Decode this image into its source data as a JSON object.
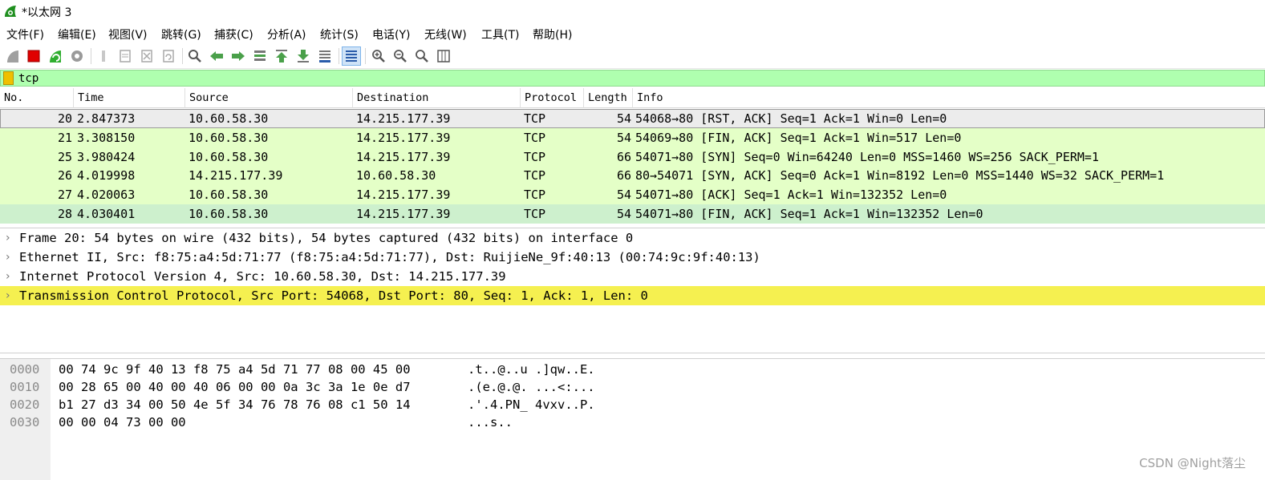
{
  "window": {
    "title": "*以太网 3",
    "accent_color": "#1f8f1f"
  },
  "menu": {
    "items": [
      "文件(F)",
      "编辑(E)",
      "视图(V)",
      "跳转(G)",
      "捕获(C)",
      "分析(A)",
      "统计(S)",
      "电话(Y)",
      "无线(W)",
      "工具(T)",
      "帮助(H)"
    ]
  },
  "toolbar": {
    "buttons": [
      "shark-fin-start-icon",
      "stop-capture-icon",
      "restart-capture-icon",
      "capture-options-icon",
      "open-file-icon",
      "save-file-icon",
      "close-file-icon",
      "reload-file-icon",
      "find-packet-icon",
      "go-back-icon",
      "go-forward-icon",
      "go-to-packet-icon",
      "go-first-icon",
      "go-last-icon",
      "autoscroll-icon",
      "colorize-icon",
      "zoom-in-icon",
      "zoom-out-icon",
      "zoom-normal-icon",
      "resize-columns-icon"
    ]
  },
  "filter": {
    "value": "tcp",
    "background_color": "#afffaf"
  },
  "packet_list": {
    "columns": [
      "No.",
      "Time",
      "Source",
      "Destination",
      "Protocol",
      "Length",
      "Info"
    ],
    "rows": [
      {
        "no": "20",
        "time": "2.847373",
        "source": "10.60.58.30",
        "destination": "14.215.177.39",
        "protocol": "TCP",
        "length": "54",
        "info": "54068→80 [RST, ACK] Seq=1 Ack=1 Win=0 Len=0",
        "color": "#ececec"
      },
      {
        "no": "21",
        "time": "3.308150",
        "source": "10.60.58.30",
        "destination": "14.215.177.39",
        "protocol": "TCP",
        "length": "54",
        "info": "54069→80 [FIN, ACK] Seq=1 Ack=1 Win=517 Len=0",
        "color": "#e4ffc7"
      },
      {
        "no": "25",
        "time": "3.980424",
        "source": "10.60.58.30",
        "destination": "14.215.177.39",
        "protocol": "TCP",
        "length": "66",
        "info": "54071→80 [SYN] Seq=0 Win=64240 Len=0 MSS=1460 WS=256 SACK_PERM=1",
        "color": "#e4ffc7"
      },
      {
        "no": "26",
        "time": "4.019998",
        "source": "14.215.177.39",
        "destination": "10.60.58.30",
        "protocol": "TCP",
        "length": "66",
        "info": "80→54071 [SYN, ACK] Seq=0 Ack=1 Win=8192 Len=0 MSS=1440 WS=32 SACK_PERM=1",
        "color": "#e4ffc7"
      },
      {
        "no": "27",
        "time": "4.020063",
        "source": "10.60.58.30",
        "destination": "14.215.177.39",
        "protocol": "TCP",
        "length": "54",
        "info": "54071→80 [ACK] Seq=1 Ack=1 Win=132352 Len=0",
        "color": "#e4ffc7"
      },
      {
        "no": "28",
        "time": "4.030401",
        "source": "10.60.58.30",
        "destination": "14.215.177.39",
        "protocol": "TCP",
        "length": "54",
        "info": "54071→80 [FIN, ACK] Seq=1 Ack=1 Win=132352 Len=0",
        "color": "#cdf0cd"
      }
    ]
  },
  "details": {
    "lines": [
      "Frame 20: 54 bytes on wire (432 bits), 54 bytes captured (432 bits) on interface 0",
      "Ethernet II, Src: f8:75:a4:5d:71:77 (f8:75:a4:5d:71:77), Dst: RuijieNe_9f:40:13 (00:74:9c:9f:40:13)",
      "Internet Protocol Version 4, Src: 10.60.58.30, Dst: 14.215.177.39",
      "Transmission Control Protocol, Src Port: 54068, Dst Port: 80, Seq: 1, Ack: 1, Len: 0"
    ],
    "selected_index": 3,
    "highlight_color": "#f5f050"
  },
  "bytes": {
    "rows": [
      {
        "offset": "0000",
        "hex": "00 74 9c 9f 40 13 f8 75  a4 5d 71 77 08 00 45 00",
        "ascii": ".t..@..u .]qw..E."
      },
      {
        "offset": "0010",
        "hex": "00 28 65 00 40 00 40 06  00 00 0a 3c 3a 1e 0e d7",
        "ascii": ".(e.@.@. ...<:..."
      },
      {
        "offset": "0020",
        "hex": "b1 27 d3 34 00 50 4e 5f  34 76 78 76 08 c1 50 14",
        "ascii": ".'.4.PN_ 4vxv..P."
      },
      {
        "offset": "0030",
        "hex": "00 00 04 73 00 00",
        "ascii": "...s.."
      }
    ]
  },
  "watermark": "CSDN @Night落尘"
}
